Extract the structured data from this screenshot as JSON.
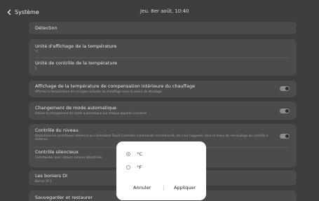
{
  "header": {
    "back_label": "Système",
    "datetime": "Jeu. 8er août, 10:40"
  },
  "settings": {
    "detection": {
      "title": "Détection"
    },
    "temp_display_unit": {
      "title": "Unité d'affichage de la température",
      "value": "°C"
    },
    "temp_control_unit": {
      "title": "Unité de contrôle de la température",
      "value": "1"
    },
    "heating_compensation": {
      "title": "Affichage de la température de compensation intérieure du chauffage",
      "subtitle": "Affichez la température de consigne actuelle du chauffage avec la valeur de décalage.",
      "toggle": "off"
    },
    "auto_mode_change": {
      "title": "Changement de mode automatique",
      "subtitle": "Activer le changement de mode automatique par chaque appareil concerné",
      "toggle": "off"
    },
    "level_control": {
      "title": "Contrôle du niveau",
      "subtitle": "Désactivez les contrôleurs intérieurs au Centralized Touch Controller (commande marche/arrêt, etc.) sur l'appareil, dans le menu de verrouillage du contrôle à distance.",
      "toggle": "off"
    },
    "silent_control": {
      "title": "Contrôle silencieux",
      "subtitle": "Commandes avec retours sonores désactivés."
    },
    "di_terminals": {
      "title": "Les boniers DI",
      "value": "Borner DI 1"
    },
    "backup_restore": {
      "title": "Sauvegarder et restaurer"
    }
  },
  "dialog": {
    "options": [
      {
        "label": "°C",
        "selected": true
      },
      {
        "label": "°F",
        "selected": false
      }
    ],
    "cancel_label": "Annuler",
    "apply_label": "Appliquer"
  }
}
